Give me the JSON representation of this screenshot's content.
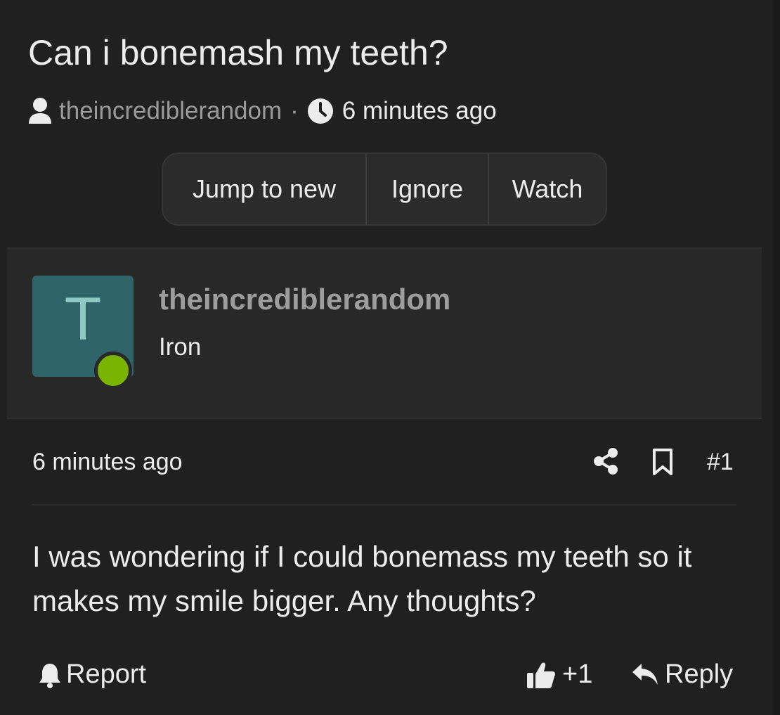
{
  "thread": {
    "title": "Can i bonemash my teeth?",
    "author": "theincrediblerandom",
    "separator": "·",
    "time": "6 minutes ago"
  },
  "actions": {
    "jump_to_new": "Jump to new",
    "ignore": "Ignore",
    "watch": "Watch"
  },
  "post": {
    "avatar_letter": "T",
    "author": "theincrediblerandom",
    "user_title": "Iron",
    "time": "6 minutes ago",
    "number": "#1",
    "body": "I was wondering if I could bonemass my teeth so it makes my smile bigger. Any thoughts?",
    "report_label": "Report",
    "like_label": "+1",
    "reply_label": "Reply"
  },
  "colors": {
    "background": "#202020",
    "avatar_bg": "#2e6468",
    "online_indicator": "#79b500",
    "muted_text": "#9a9a9a"
  },
  "icons": {
    "user": "user-icon",
    "clock": "clock-icon",
    "share": "share-icon",
    "bookmark": "bookmark-icon",
    "bell": "bell-icon",
    "like": "thumbs-up-icon",
    "reply": "reply-icon"
  }
}
